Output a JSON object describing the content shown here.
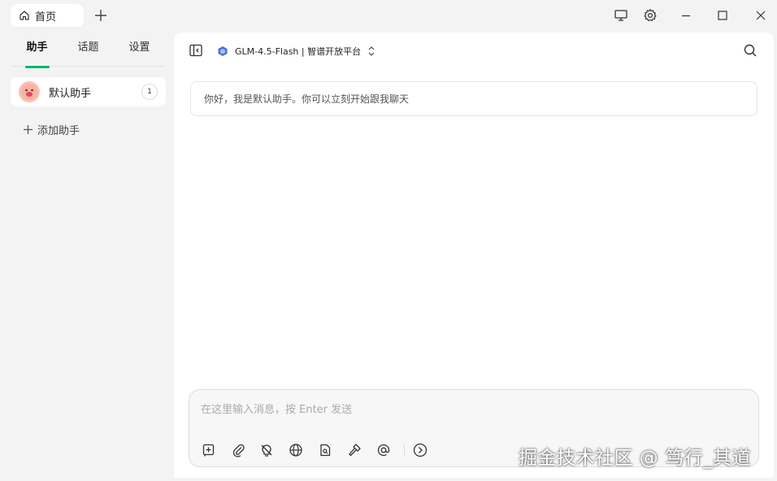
{
  "titlebar": {
    "home_tab_label": "首页",
    "icons": [
      "home-icon",
      "plus-icon",
      "monitor-icon",
      "gear-icon",
      "minimize-icon",
      "maximize-icon",
      "close-icon"
    ]
  },
  "sidebar": {
    "tabs": [
      {
        "label": "助手",
        "active": true
      },
      {
        "label": "话题",
        "active": false
      },
      {
        "label": "设置",
        "active": false
      }
    ],
    "assistants": [
      {
        "name": "默认助手",
        "count": "1"
      }
    ],
    "add_label": "添加助手"
  },
  "main": {
    "model_label": "GLM-4.5-Flash | 智谱开放平台",
    "welcome_text": "你好，我是默认助手。你可以立刻开始跟我聊天",
    "composer": {
      "value": "",
      "placeholder": "在这里输入消息，按 Enter 发送"
    },
    "tools": [
      "new-topic-icon",
      "attachment-icon",
      "thinking-off-icon",
      "globe-icon",
      "knowledge-icon",
      "hammer-icon",
      "mention-icon",
      "arrow-right-icon"
    ]
  },
  "colors": {
    "accent": "#00b96b",
    "background": "#f3f3f3",
    "panel": "#ffffff"
  },
  "watermark": "掘金技术社区 @ 笃行_其道"
}
